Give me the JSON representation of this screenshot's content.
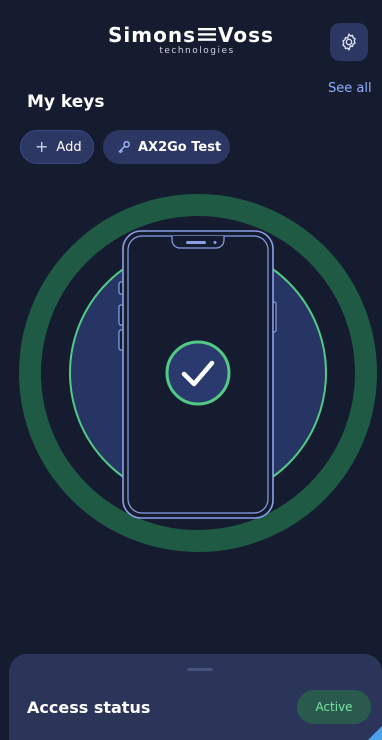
{
  "header": {
    "logo_main": "SimonsVoss",
    "logo_sub": "technologies",
    "logo_icon": "triple-bar-logo-mark",
    "settings_icon": "gear-icon"
  },
  "keys": {
    "title": "My keys",
    "see_all_label": "See all",
    "add_label": "Add",
    "add_icon": "plus-icon",
    "chips": [
      {
        "label": "AX2Go Test",
        "icon": "key-icon"
      }
    ]
  },
  "illustration": {
    "icon": "phone-with-checkmark-icon",
    "state": "success"
  },
  "access": {
    "label": "Access status",
    "status": "Active"
  },
  "colors": {
    "background": "#161c30",
    "chip_bg": "#2c3763",
    "accent_green": "#52c985",
    "ring_outer": "#1f5a45",
    "link": "#8fb0ff"
  }
}
